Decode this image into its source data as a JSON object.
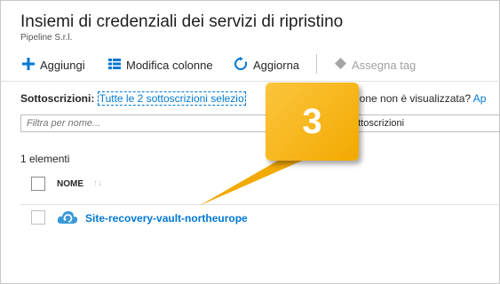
{
  "header": {
    "title": "Insiemi di credenziali dei servizi di ripristino",
    "subtitle": "Pipeline S.r.l."
  },
  "toolbar": {
    "add_label": "Aggiungi",
    "edit_columns_label": "Modifica colonne",
    "refresh_label": "Aggiorna",
    "assign_tag_label": "Assegna tag"
  },
  "subscriptions": {
    "label": "Sottoscrizioni:",
    "link_text": "Tutte le 2 sottoscrizioni selezio",
    "question_tail": "ione non è visualizzata?",
    "question_link": "Ap"
  },
  "filter": {
    "placeholder": "Filtra per nome...",
    "subscriptions_select": "ottoscrizioni"
  },
  "list": {
    "count_label": "1 elementi",
    "column_name": "NOME",
    "sort_indicator": "↑↓",
    "rows": [
      {
        "name": "Site-recovery-vault-northeurope",
        "icon": "recovery-vault-cloud-icon"
      }
    ]
  },
  "callout": {
    "number": "3",
    "color": "#f5b41a"
  },
  "colors": {
    "link": "#0078d4",
    "accent": "#0078d4"
  }
}
